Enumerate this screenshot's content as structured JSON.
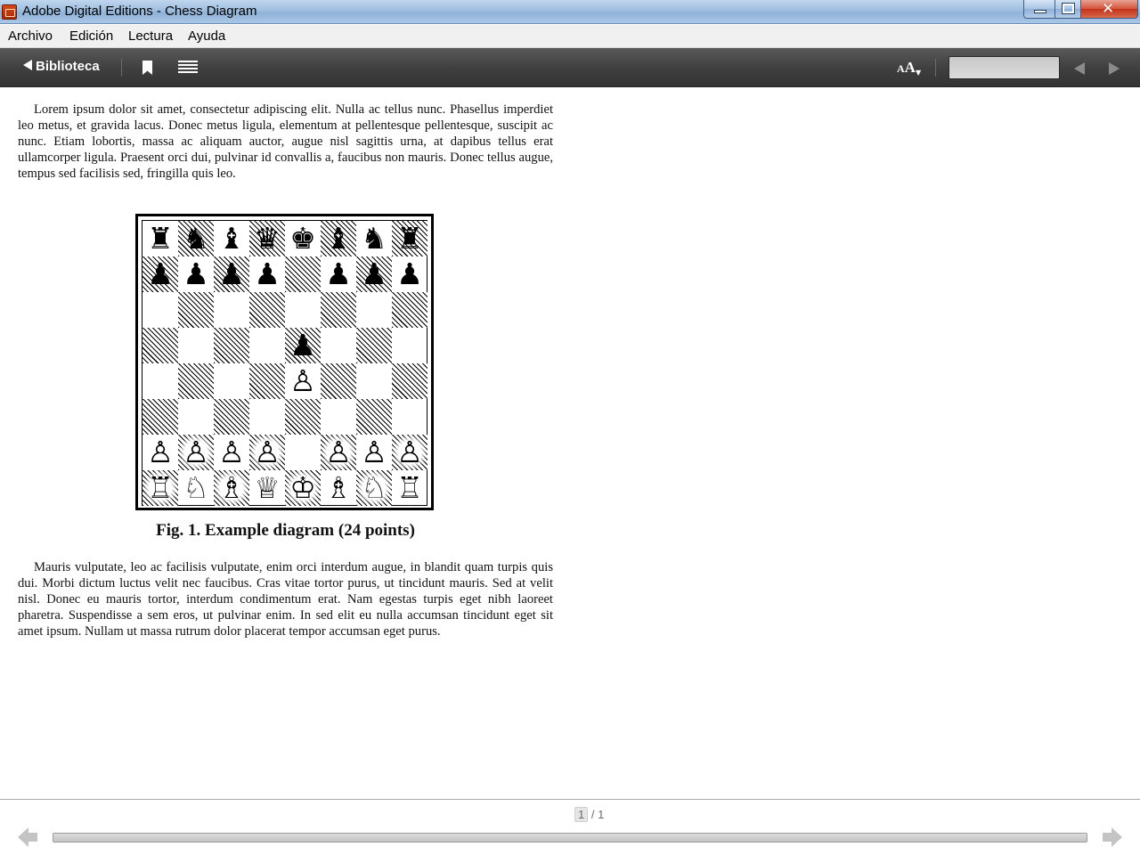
{
  "window": {
    "title": "Adobe Digital Editions - Chess Diagram",
    "close_glyph": "✕"
  },
  "menu": {
    "items": [
      "Archivo",
      "Edición",
      "Lectura",
      "Ayuda"
    ]
  },
  "toolbar": {
    "library_label": "Biblioteca",
    "font_label_big": "A",
    "font_label_small": "A",
    "search_value": ""
  },
  "document": {
    "paragraph_1": "Lorem ipsum dolor sit amet, consectetur adipiscing elit. Nulla ac tellus nunc. Phasellus imperdiet leo metus, et gravida lacus. Donec metus ligula, elementum at pellentesque pellentesque, suscipit ac nunc. Etiam lobortis, massa ac aliquam auctor, augue nisl sagittis urna, at dapibus tellus erat ullamcorper ligula. Praesent orci dui, pulvinar id convallis a, faucibus non mauris. Donec tellus augue, tempus sed facilisis sed, fringilla quis leo.",
    "caption": "Fig. 1. Example diagram (24 points)",
    "paragraph_2": "Mauris vulputate, leo ac facilisis vulputate, enim orci interdum augue, in blandit quam turpis quis dui. Morbi dictum luctus velit nec faucibus. Cras vitae tortor purus, ut tincidunt mauris. Sed at velit nisl. Donec eu mauris tortor, interdum condimentum erat. Nam egestas turpis eget nibh laoreet pharetra. Suspendisse a sem eros, ut pulvinar enim. In sed elit eu nulla accumsan tincidunt eget sit amet ipsum. Nullam ut massa rutrum dolor placerat tempor accumsan eget purus.",
    "board_rows": [
      [
        "r",
        "n",
        "b",
        "q",
        "k",
        "b",
        "n",
        "r"
      ],
      [
        "p",
        "p",
        "p",
        "p",
        "",
        "p",
        "p",
        "p"
      ],
      [
        "",
        "",
        "",
        "",
        "",
        "",
        "",
        ""
      ],
      [
        "",
        "",
        "",
        "",
        "p",
        "",
        "",
        ""
      ],
      [
        "",
        "",
        "",
        "",
        "P",
        "",
        "",
        ""
      ],
      [
        "",
        "",
        "",
        "",
        "",
        "",
        "",
        ""
      ],
      [
        "P",
        "P",
        "P",
        "P",
        "",
        "P",
        "P",
        "P"
      ],
      [
        "R",
        "N",
        "B",
        "Q",
        "K",
        "B",
        "N",
        "R"
      ]
    ]
  },
  "pager": {
    "current": "1",
    "separator": "/",
    "total": "1"
  },
  "icons": {
    "bookmark": "bookmark-icon",
    "toc": "table-of-contents-icon",
    "font_size": "font-size-icon",
    "prev": "previous-page-icon",
    "next": "next-page-icon"
  }
}
